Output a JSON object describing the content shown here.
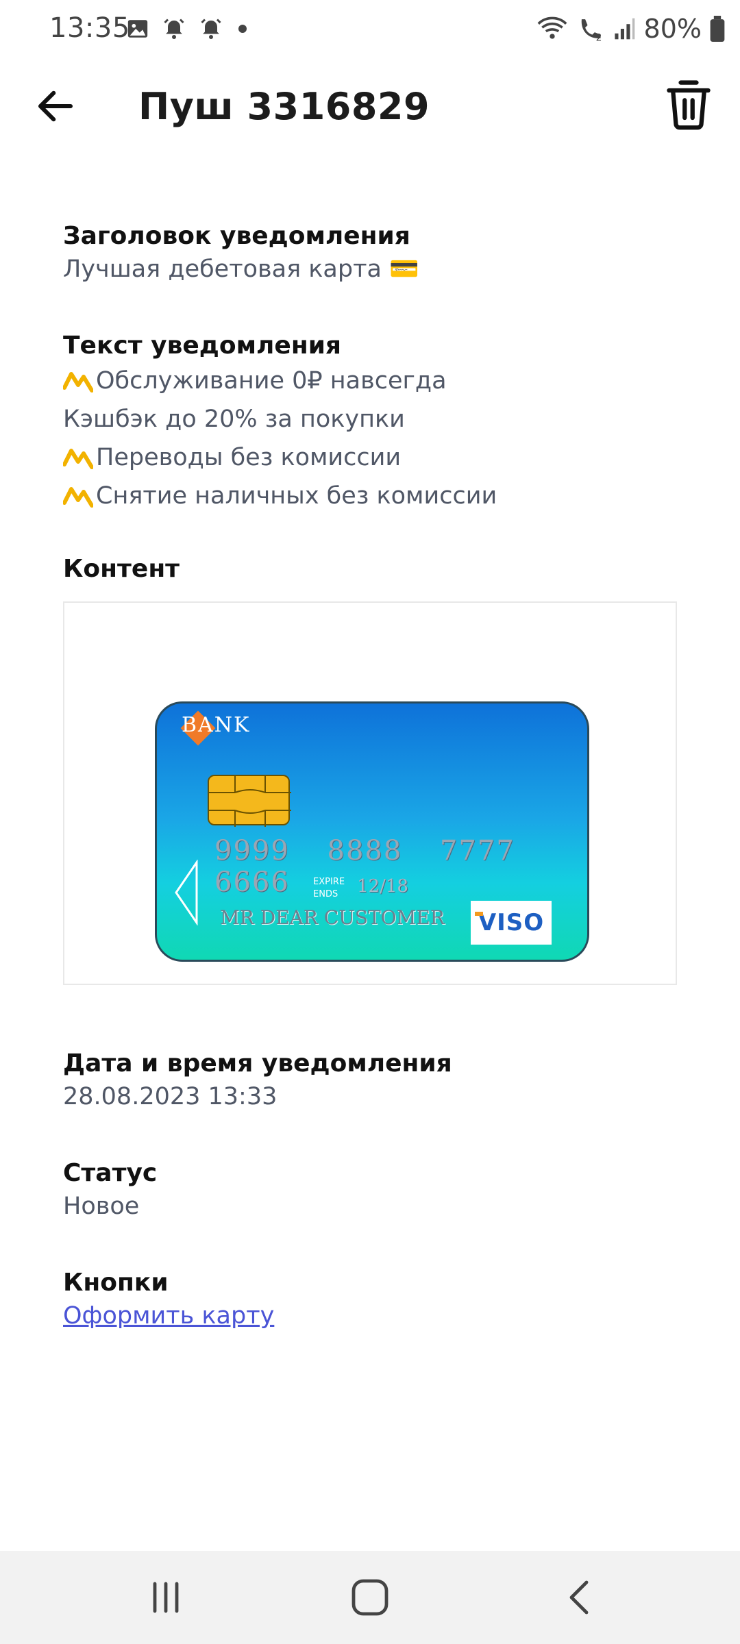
{
  "status_bar": {
    "time": "13:35",
    "battery_text": "80%",
    "icons": [
      "gallery-icon",
      "alarm-icon",
      "alarm-icon",
      "dot-icon",
      "wifi-icon",
      "call-icon",
      "signal-icon",
      "battery-icon"
    ]
  },
  "app_bar": {
    "title": "Пуш 3316829"
  },
  "sections": {
    "notification_title": {
      "label": "Заголовок уведомления",
      "value": "Лучшая дебетовая карта 💳"
    },
    "notification_text": {
      "label": "Текст уведомления",
      "lines": [
        {
          "text": "Обслуживание 0₽ навсегда",
          "has_icon": true
        },
        {
          "text": "Кэшбэк до 20% за покупки",
          "has_icon": false
        },
        {
          "text": "Переводы без комиссии",
          "has_icon": true
        },
        {
          "text": "Снятие наличных без комиссии",
          "has_icon": true
        }
      ]
    },
    "content": {
      "label": "Контент",
      "card": {
        "bank": "BANK",
        "number": "9999 8888 7777 6666",
        "expire_label_1": "EXPIRE",
        "expire_label_2": "ENDS",
        "expire_date": "12/18",
        "holder": "MR DEAR CUSTOMER",
        "logo": "VISO"
      }
    },
    "datetime": {
      "label": "Дата и время уведомления",
      "value": "28.08.2023 13:33"
    },
    "status": {
      "label": "Статус",
      "value": "Новое"
    },
    "buttons": {
      "label": "Кнопки",
      "link": "Оформить карту"
    }
  },
  "colors": {
    "accent_link": "#4a54d6",
    "value_text": "#505766",
    "card_top": "#0e72d9",
    "card_bottom": "#10d8b4"
  }
}
